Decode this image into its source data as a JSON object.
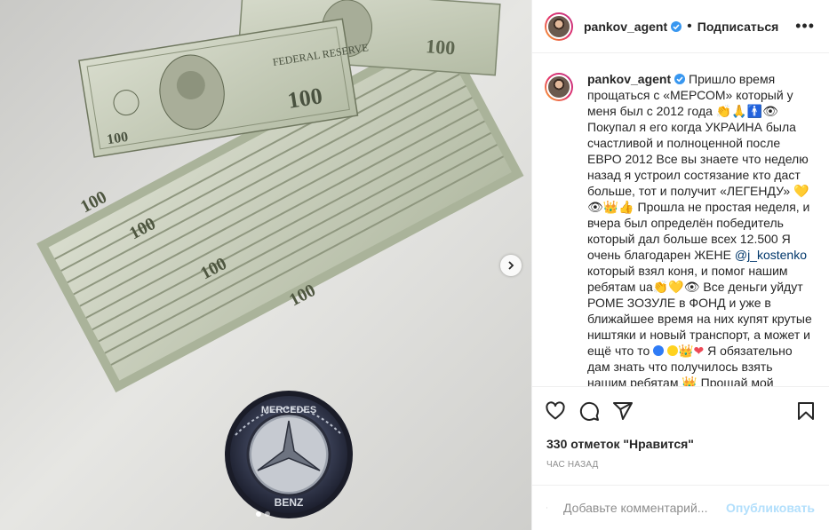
{
  "post": {
    "username": "pankov_agent",
    "follow_label": "Подписаться",
    "separator": "•",
    "more_label": "•••",
    "caption": {
      "username": "pankov_agent",
      "p1": " Пришло время прощаться с «МЕРСОМ» который у меня был с 2012 года ",
      "p2": " Покупал я его когда УКРАИНА была счастливой и полноценной после ЕВРО 2012 Все вы знаете что неделю назад я устроил состязание кто даст больше, тот и получит «ЛЕГЕНДУ» ",
      "p3": " Прошла не простая неделя, и вчера был определён победитель который дал больше всех 12.500 Я очень благодарен ЖЕНЕ ",
      "mention": "@j_kostenko",
      "p4": " который взял коня, и помог нашим ребятам ua",
      "p5": " Все деньги уйдут РОМЕ ЗОЗУЛЕ в ФОНД и уже в ближайшее время на них купят крутые ништяки и новый транспорт, а может и ещё что то ",
      "p6": " Я обязательно дам знать что получилось взять нашим ребятам ",
      "p7": " Прощай мой"
    },
    "likes": "330 отметок \"Нравится\"",
    "timestamp": "ЧАС НАЗАД",
    "comment_placeholder": "Добавьте комментарий...",
    "post_button": "Опубликовать"
  },
  "media": {
    "badge_top": "100",
    "badge_bottom": "BENZ",
    "emblem_top_text": "MERCEDES",
    "carousel_total": 2,
    "carousel_active": 1
  },
  "colors": {
    "verified": "#3897f0",
    "link": "#00376b",
    "muted": "#8e8e8e",
    "post_disabled": "#b2dffc",
    "bill_green": "#c3cbb5"
  }
}
